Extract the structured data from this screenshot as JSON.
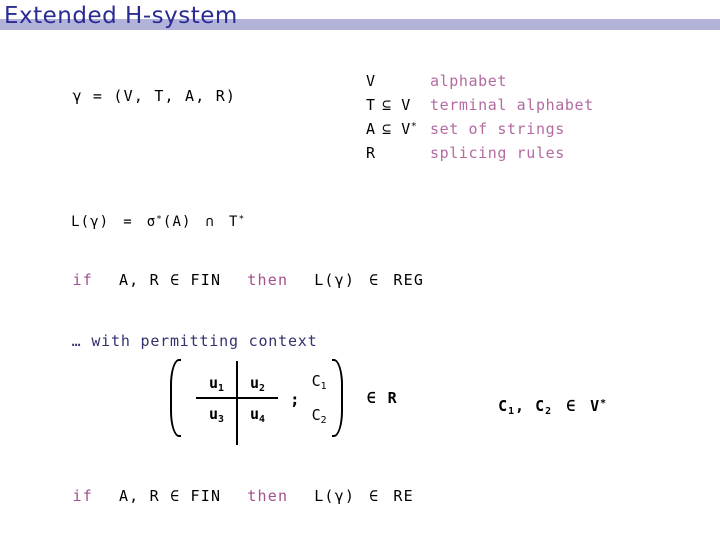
{
  "slide": {
    "title": "Extended H-system",
    "title_color": "#2b2b94",
    "band_color": "#b3b3da",
    "accent_pink": "#b46aa0",
    "keyword_color": "#a0508c",
    "note_color": "#32326e",
    "body_color": "#000000",
    "background": "#ffffff"
  },
  "gamma_definition": {
    "text": "γ = (V, T, A, R)"
  },
  "legend": {
    "rows": [
      {
        "symbol": "V",
        "relation": "",
        "description": "alphabet"
      },
      {
        "symbol": "T",
        "relation": "⊆ V",
        "description": "terminal alphabet"
      },
      {
        "symbol": "A",
        "relation": "⊆ V*",
        "relation_base": "⊆ V",
        "relation_sup": "*",
        "description": "set of strings"
      },
      {
        "symbol": "R",
        "relation": "",
        "description": "splicing rules"
      }
    ]
  },
  "language_definition": {
    "lhs": "L(γ)",
    "eq": "=",
    "rhs_1_base": "σ",
    "rhs_1_sup": "*",
    "rhs_1_arg": "(A)",
    "operator": "∩",
    "rhs_2_base": "T",
    "rhs_2_sup": "*",
    "full": "L(γ) = σ*(A) ∩ T*"
  },
  "conditional_1": {
    "if": "if",
    "premise": "A, R ∈ FIN",
    "then": "then",
    "conclusion_lhs": "L(γ)",
    "conclusion_rel": "∈",
    "conclusion_rhs": "REG"
  },
  "context_note": {
    "text": "… with permitting context"
  },
  "splicing_rule": {
    "matrix": {
      "row1": [
        "u₁",
        "u₂"
      ],
      "row2": [
        "u₃",
        "u₄"
      ],
      "cells": {
        "u1_base": "u",
        "u1_sub": "1",
        "u2_base": "u",
        "u2_sub": "2",
        "u3_base": "u",
        "u3_sub": "3",
        "u4_base": "u",
        "u4_sub": "4"
      }
    },
    "separator": ";",
    "contexts": {
      "c1_base": "C",
      "c1_sub": "1",
      "c2_base": "C",
      "c2_sub": "2"
    },
    "membership": "∈ R",
    "bracket_left": "[",
    "bracket_right": "]"
  },
  "context_alphabet": {
    "c1_base": "C",
    "c1_sub": "1",
    "separator": ", ",
    "c2_base": "C",
    "c2_sub": "2",
    "relation": "∈",
    "set_base": "V",
    "set_sup": "*",
    "full": "C₁, C₂ ∈ V*"
  },
  "conditional_2": {
    "if": "if",
    "premise": "A, R ∈ FIN",
    "then": "then",
    "conclusion_lhs": "L(γ)",
    "conclusion_rel": "∈",
    "conclusion_rhs": "RE"
  }
}
